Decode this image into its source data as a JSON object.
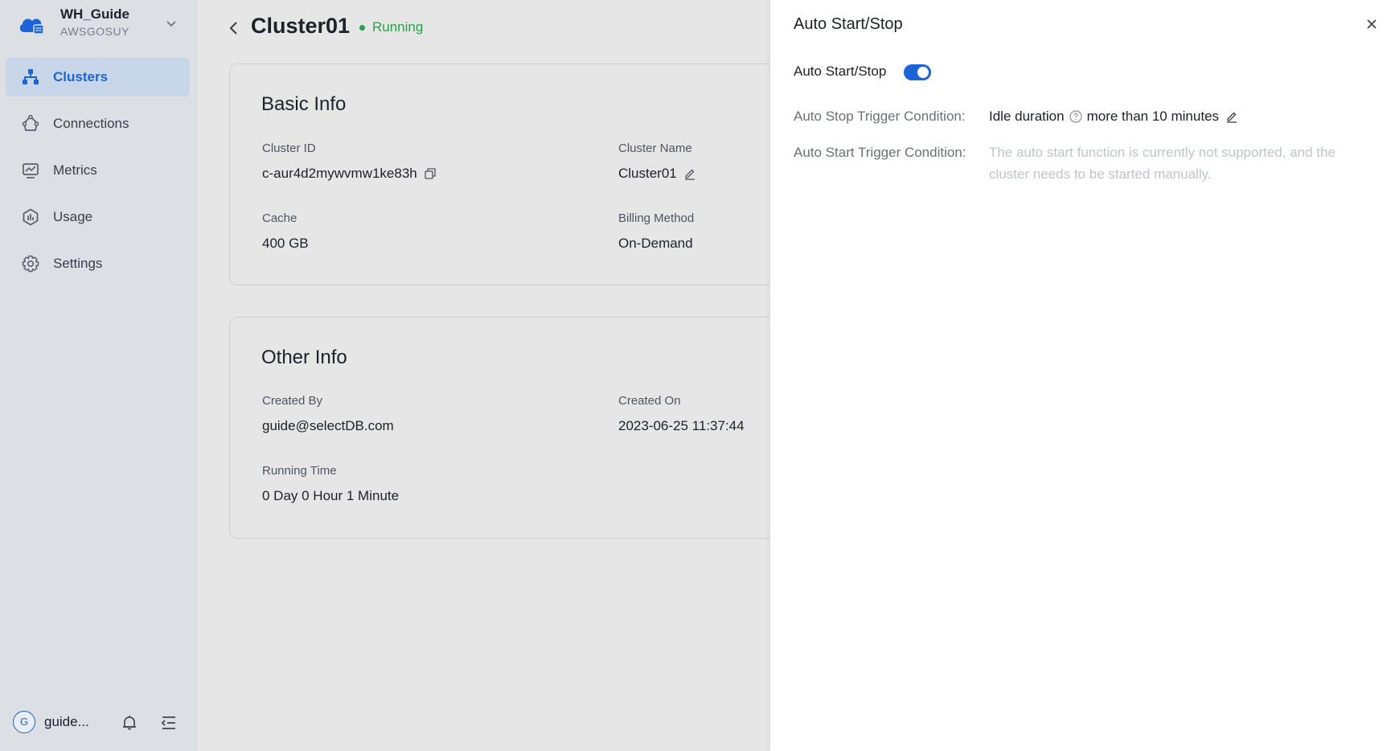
{
  "workspace": {
    "name": "WH_Guide",
    "id": "AWSGOSUY"
  },
  "sidebar": {
    "items": [
      {
        "label": "Clusters",
        "icon": "cluster-icon",
        "active": true
      },
      {
        "label": "Connections",
        "icon": "connections-icon",
        "active": false
      },
      {
        "label": "Metrics",
        "icon": "metrics-icon",
        "active": false
      },
      {
        "label": "Usage",
        "icon": "usage-icon",
        "active": false
      },
      {
        "label": "Settings",
        "icon": "settings-icon",
        "active": false
      }
    ]
  },
  "user": {
    "avatar_letter": "G",
    "name": "guide..."
  },
  "header": {
    "title": "Cluster01",
    "status": "Running"
  },
  "basic_info": {
    "title": "Basic Info",
    "cluster_id_label": "Cluster ID",
    "cluster_id": "c-aur4d2mywvmw1ke83h",
    "cluster_name_label": "Cluster Name",
    "cluster_name": "Cluster01",
    "cache_label": "Cache",
    "cache": "400 GB",
    "billing_label": "Billing Method",
    "billing": "On-Demand"
  },
  "other_info": {
    "title": "Other Info",
    "created_by_label": "Created By",
    "created_by": "guide@selectDB.com",
    "created_on_label": "Created On",
    "created_on": "2023-06-25 11:37:44",
    "running_time_label": "Running Time",
    "running_time": "0 Day 0 Hour 1 Minute"
  },
  "panel": {
    "title": "Auto Start/Stop",
    "toggle_label": "Auto Start/Stop",
    "toggle_on": true,
    "stop_label": "Auto Stop Trigger Condition:",
    "stop_idle": "Idle duration",
    "stop_more": "more than 10 minutes",
    "start_label": "Auto Start Trigger Condition:",
    "start_note": "The auto start function is currently not supported, and the cluster needs to be started manually."
  },
  "colors": {
    "accent": "#1c64d8",
    "status_running": "#27a24a",
    "sidebar_bg": "#dcdfe4",
    "active_item_bg": "#c8d6ea"
  }
}
